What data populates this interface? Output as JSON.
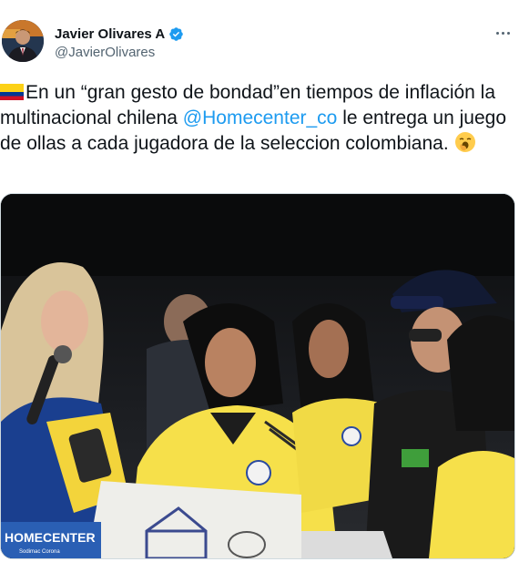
{
  "author": {
    "name": "Javier Olivares A",
    "handle": "@JavierOlivares",
    "verified": true,
    "avatar_icon": "avatar-photo"
  },
  "tweet": {
    "flag_icon": "colombia-flag-emoji",
    "text_part1": "En un “gran gesto de bondad”en tiempos de inflación la multinacional chilena ",
    "mention": "@Homecenter_co",
    "text_part2": " le entrega un juego de ollas a cada jugadora de la seleccion colombiana. ",
    "emoji_icon": "yawning-face-emoji"
  },
  "media": {
    "description_icon": "tv-screen-photo",
    "banner_text": "HOMECENTER",
    "banner_subtext": "Sodimac Corona"
  },
  "colors": {
    "accent": "#1d9bf0",
    "text": "#0f1419",
    "muted": "#536471",
    "jersey_yellow": "#f6e04a"
  }
}
